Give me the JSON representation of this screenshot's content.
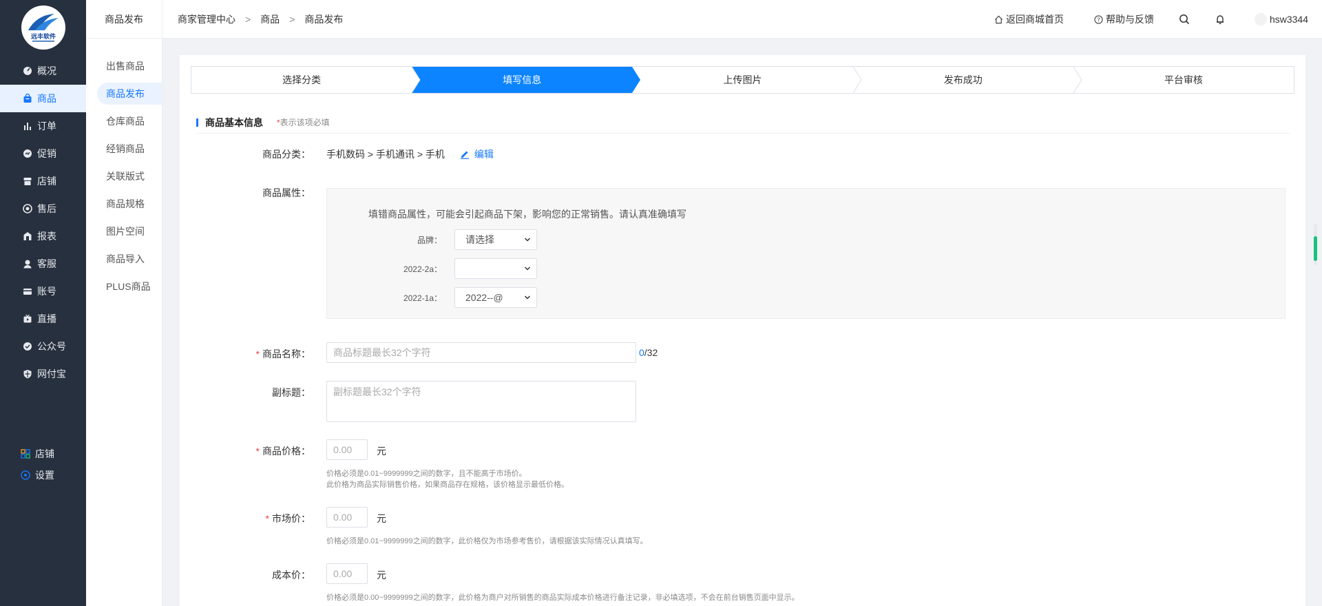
{
  "sidebar": {
    "logo_text": "远丰软件",
    "items": [
      {
        "label": "概况",
        "icon": "dashboard-icon"
      },
      {
        "label": "商品",
        "icon": "bag-icon"
      },
      {
        "label": "订单",
        "icon": "bar-chart-icon"
      },
      {
        "label": "促销",
        "icon": "promotion-icon"
      },
      {
        "label": "店铺",
        "icon": "shop-icon"
      },
      {
        "label": "售后",
        "icon": "after-sales-icon"
      },
      {
        "label": "报表",
        "icon": "report-icon"
      },
      {
        "label": "客服",
        "icon": "customer-service-icon"
      },
      {
        "label": "账号",
        "icon": "card-icon"
      },
      {
        "label": "直播",
        "icon": "live-icon"
      },
      {
        "label": "公众号",
        "icon": "verified-icon"
      },
      {
        "label": "网付宝",
        "icon": "shield-icon"
      }
    ],
    "active_index": 1,
    "bottom": [
      {
        "label": "店铺",
        "icon": "grid-icon"
      },
      {
        "label": "设置",
        "icon": "settings-icon"
      }
    ],
    "accent": "#1677ff",
    "bg": "#27303e"
  },
  "submenu": {
    "title": "商品发布",
    "items": [
      "出售商品",
      "商品发布",
      "仓库商品",
      "经销商品",
      "关联版式",
      "商品规格",
      "图片空间",
      "商品导入",
      "PLUS商品"
    ],
    "active_index": 1
  },
  "header": {
    "breadcrumb": [
      "商家管理中心",
      "商品",
      "商品发布"
    ],
    "separator": ">",
    "home_link": "返回商城首页",
    "help_link": "帮助与反馈",
    "username": "hsw3344"
  },
  "steps": {
    "items": [
      "选择分类",
      "填写信息",
      "上传图片",
      "发布成功",
      "平台审核"
    ],
    "active_index": 1,
    "active_color": "#0d84ff"
  },
  "form": {
    "section_title": "商品基本信息",
    "required_mark": "*",
    "section_note": "表示该项必填",
    "category": {
      "label": "商品分类：",
      "path": "手机数码 > 手机通讯 > 手机",
      "edit_label": "编辑"
    },
    "attributes": {
      "label": "商品属性：",
      "tip": "填错商品属性，可能会引起商品下架，影响您的正常销售。请认真准确填写",
      "rows": [
        {
          "label": "品牌：",
          "value": "请选择"
        },
        {
          "label": "2022-2a：",
          "value": ""
        },
        {
          "label": "2022-1a：",
          "value": "2022--@"
        }
      ]
    },
    "name": {
      "label": "商品名称：",
      "placeholder": "商品标题最长32个字符",
      "count_current": "0",
      "count_rest": "/32"
    },
    "subtitle": {
      "label": "副标题：",
      "placeholder": "副标题最长32个字符"
    },
    "price": {
      "label": "商品价格：",
      "placeholder": "0.00",
      "unit": "元",
      "hint1": "价格必须是0.01~9999999之间的数字，且不能高于市场价。",
      "hint2": "此价格为商品实际销售价格，如果商品存在规格，该价格显示最低价格。"
    },
    "market_price": {
      "label": "市场价：",
      "placeholder": "0.00",
      "unit": "元",
      "hint": "价格必须是0.01~9999999之间的数字，此价格仅为市场参考售价，请根据该实际情况认真填写。"
    },
    "cost_price": {
      "label": "成本价：",
      "placeholder": "0.00",
      "unit": "元",
      "hint": "价格必须是0.00~9999999之间的数字，此价格为商户对所销售的商品实际成本价格进行备注记录，非必填选项，不会在前台销售页面中显示。"
    }
  }
}
